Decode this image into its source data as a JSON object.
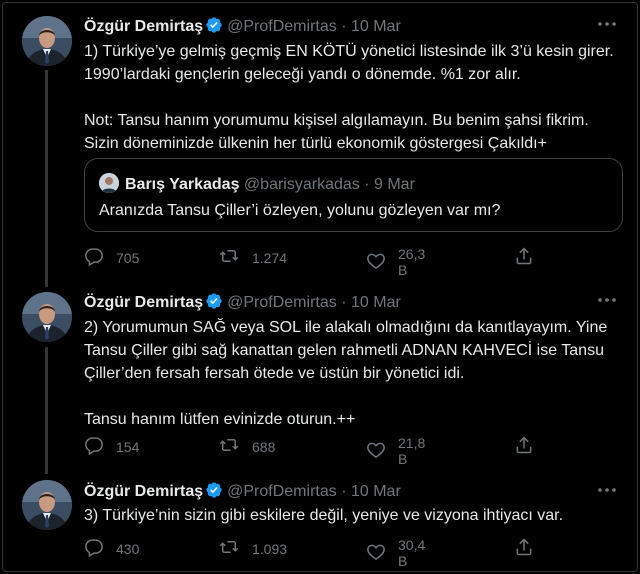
{
  "tweets": [
    {
      "name": "Özgür Demirtaş",
      "handle": "@ProfDemirtas",
      "dot": "·",
      "date": "10 Mar",
      "text": "1) Türkiye’ye gelmiş geçmiş EN KÖTÜ yönetici listesinde ilk 3’ü kesin girer. 1990’lardaki gençlerin geleceği yandı o dönemde. %1 zor alır.\n\nNot: Tansu hanım yorumumu kişisel algılamayın. Bu benim şahsi fikrim. Sizin döneminizde ülkenin her türlü ekonomik göstergesi Çakıldı+",
      "quote": {
        "name": "Barış Yarkadaş",
        "handle": "@barisyarkadas",
        "dot": "·",
        "date": "9 Mar",
        "text": "Aranızda Tansu Çiller’i özleyen, yolunu gözleyen var mı?"
      },
      "replies": "705",
      "retweets": "1.274",
      "likes": "26,3 B"
    },
    {
      "name": "Özgür Demirtaş",
      "handle": "@ProfDemirtas",
      "dot": "·",
      "date": "10 Mar",
      "text": "2) Yorumumun SAĞ veya SOL ile alakalı olmadığını da kanıtlayayım. Yine Tansu Çiller gibi sağ kanattan gelen rahmetli ADNAN KAHVECİ ise Tansu Çiller’den fersah fersah ötede ve üstün bir yönetici idi.\n\nTansu hanım lütfen evinizde oturun.++",
      "replies": "154",
      "retweets": "688",
      "likes": "21,8 B"
    },
    {
      "name": "Özgür Demirtaş",
      "handle": "@ProfDemirtas",
      "dot": "·",
      "date": "10 Mar",
      "text": "3) Türkiye’nin sizin gibi eskilere değil, yeniye ve vizyona ihtiyacı var.",
      "replies": "430",
      "retweets": "1.093",
      "likes": "30,4 B"
    }
  ],
  "colors": {
    "background": "#000000",
    "text": "#e7e9ea",
    "muted": "#71767b",
    "verified": "#1d9bf0",
    "border": "#2f3336"
  },
  "icons": [
    "verified-badge-icon",
    "more-icon",
    "reply-icon",
    "retweet-icon",
    "like-icon",
    "share-icon"
  ]
}
